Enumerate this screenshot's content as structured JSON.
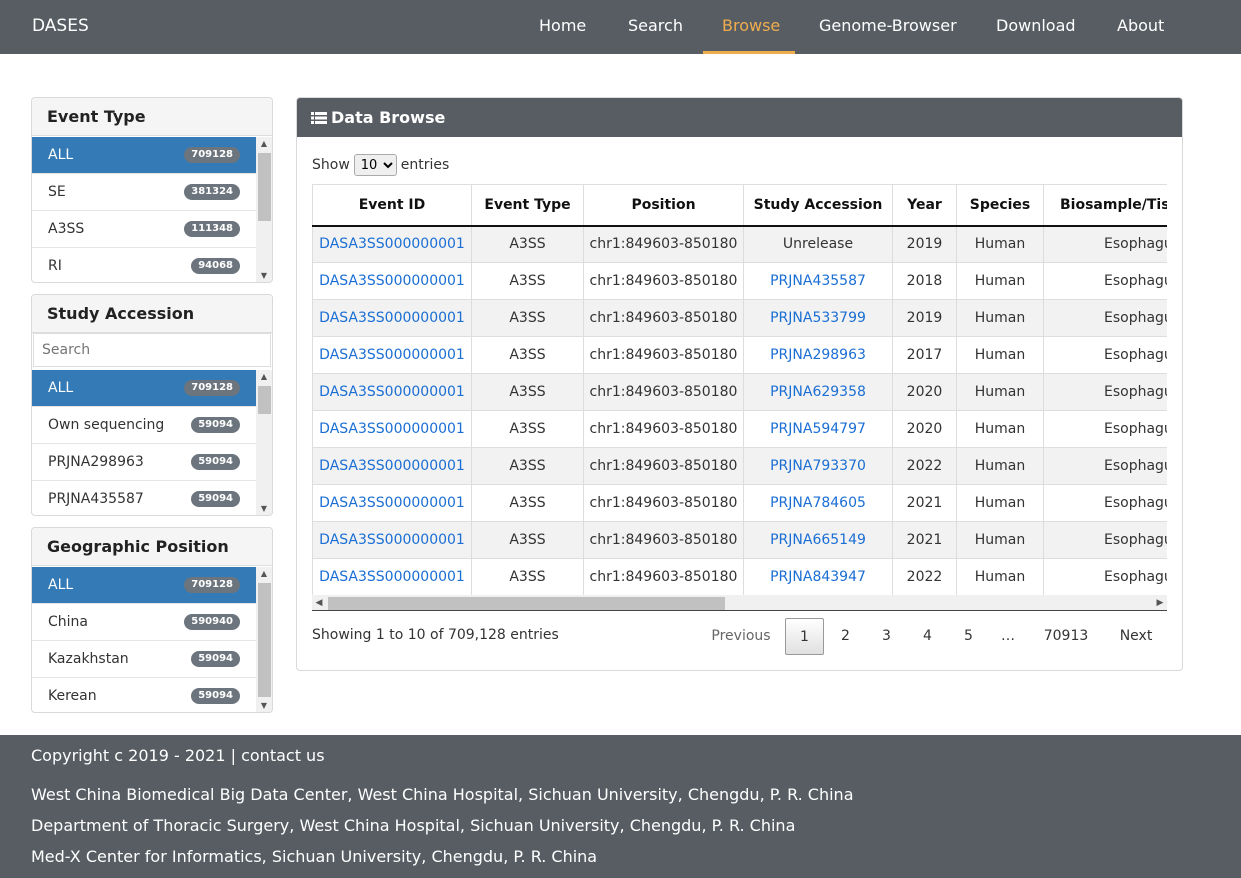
{
  "navbar": {
    "brand": "DASES",
    "links": [
      "Home",
      "Search",
      "Browse",
      "Genome-Browser",
      "Download",
      "About"
    ],
    "active": "Browse",
    "accent": "#f0ad4e",
    "background": "#575d63"
  },
  "event_type": {
    "title": "Event Type",
    "items": [
      {
        "label": "ALL",
        "count": "709128",
        "active": true
      },
      {
        "label": "SE",
        "count": "381324"
      },
      {
        "label": "A3SS",
        "count": "111348"
      },
      {
        "label": "RI",
        "count": "94068"
      }
    ]
  },
  "study_accession": {
    "title": "Study Accession",
    "search_placeholder": "Search",
    "items": [
      {
        "label": "ALL",
        "count": "709128",
        "active": true
      },
      {
        "label": "Own sequencing",
        "count": "59094"
      },
      {
        "label": "PRJNA298963",
        "count": "59094"
      },
      {
        "label": "PRJNA435587",
        "count": "59094"
      }
    ]
  },
  "geo_position": {
    "title": "Geographic Position",
    "items": [
      {
        "label": "ALL",
        "count": "709128",
        "active": true
      },
      {
        "label": "China",
        "count": "590940"
      },
      {
        "label": "Kazakhstan",
        "count": "59094"
      },
      {
        "label": "Kerean",
        "count": "59094"
      }
    ]
  },
  "main": {
    "title": "Data Browse",
    "icon": "list-icon",
    "show_label": "Show",
    "entries_label": "entries",
    "page_size": "10",
    "page_size_options": [
      "10"
    ],
    "columns": [
      "Event ID",
      "Event Type",
      "Position",
      "Study Accession",
      "Year",
      "Species",
      "Biosample/Tiss"
    ],
    "rows": [
      {
        "event_id": "DASA3SS000000001",
        "event_type": "A3SS",
        "position": "chr1:849603-850180",
        "study": "Unrelease",
        "study_link": false,
        "year": "2019",
        "species": "Human",
        "biosample": "Esophagu"
      },
      {
        "event_id": "DASA3SS000000001",
        "event_type": "A3SS",
        "position": "chr1:849603-850180",
        "study": "PRJNA435587",
        "study_link": true,
        "year": "2018",
        "species": "Human",
        "biosample": "Esophagu"
      },
      {
        "event_id": "DASA3SS000000001",
        "event_type": "A3SS",
        "position": "chr1:849603-850180",
        "study": "PRJNA533799",
        "study_link": true,
        "year": "2019",
        "species": "Human",
        "biosample": "Esophagu"
      },
      {
        "event_id": "DASA3SS000000001",
        "event_type": "A3SS",
        "position": "chr1:849603-850180",
        "study": "PRJNA298963",
        "study_link": true,
        "year": "2017",
        "species": "Human",
        "biosample": "Esophagu"
      },
      {
        "event_id": "DASA3SS000000001",
        "event_type": "A3SS",
        "position": "chr1:849603-850180",
        "study": "PRJNA629358",
        "study_link": true,
        "year": "2020",
        "species": "Human",
        "biosample": "Esophagu"
      },
      {
        "event_id": "DASA3SS000000001",
        "event_type": "A3SS",
        "position": "chr1:849603-850180",
        "study": "PRJNA594797",
        "study_link": true,
        "year": "2020",
        "species": "Human",
        "biosample": "Esophagu"
      },
      {
        "event_id": "DASA3SS000000001",
        "event_type": "A3SS",
        "position": "chr1:849603-850180",
        "study": "PRJNA793370",
        "study_link": true,
        "year": "2022",
        "species": "Human",
        "biosample": "Esophagu"
      },
      {
        "event_id": "DASA3SS000000001",
        "event_type": "A3SS",
        "position": "chr1:849603-850180",
        "study": "PRJNA784605",
        "study_link": true,
        "year": "2021",
        "species": "Human",
        "biosample": "Esophagu"
      },
      {
        "event_id": "DASA3SS000000001",
        "event_type": "A3SS",
        "position": "chr1:849603-850180",
        "study": "PRJNA665149",
        "study_link": true,
        "year": "2021",
        "species": "Human",
        "biosample": "Esophagu"
      },
      {
        "event_id": "DASA3SS000000001",
        "event_type": "A3SS",
        "position": "chr1:849603-850180",
        "study": "PRJNA843947",
        "study_link": true,
        "year": "2022",
        "species": "Human",
        "biosample": "Esophagu"
      }
    ],
    "info": "Showing 1 to 10 of 709,128 entries",
    "pagination": {
      "previous": "Previous",
      "pages": [
        "1",
        "2",
        "3",
        "4",
        "5",
        "…",
        "70913"
      ],
      "current": "1",
      "next": "Next"
    }
  },
  "footer": {
    "copyright": "Copyright c 2019 - 2021 | contact us",
    "lines": [
      "West China Biomedical Big Data Center, West China Hospital, Sichuan University, Chengdu, P. R. China",
      "Department of Thoracic Surgery, West China Hospital, Sichuan University, Chengdu, P. R. China",
      "Med-X Center for Informatics, Sichuan University, Chengdu, P. R. China"
    ]
  }
}
